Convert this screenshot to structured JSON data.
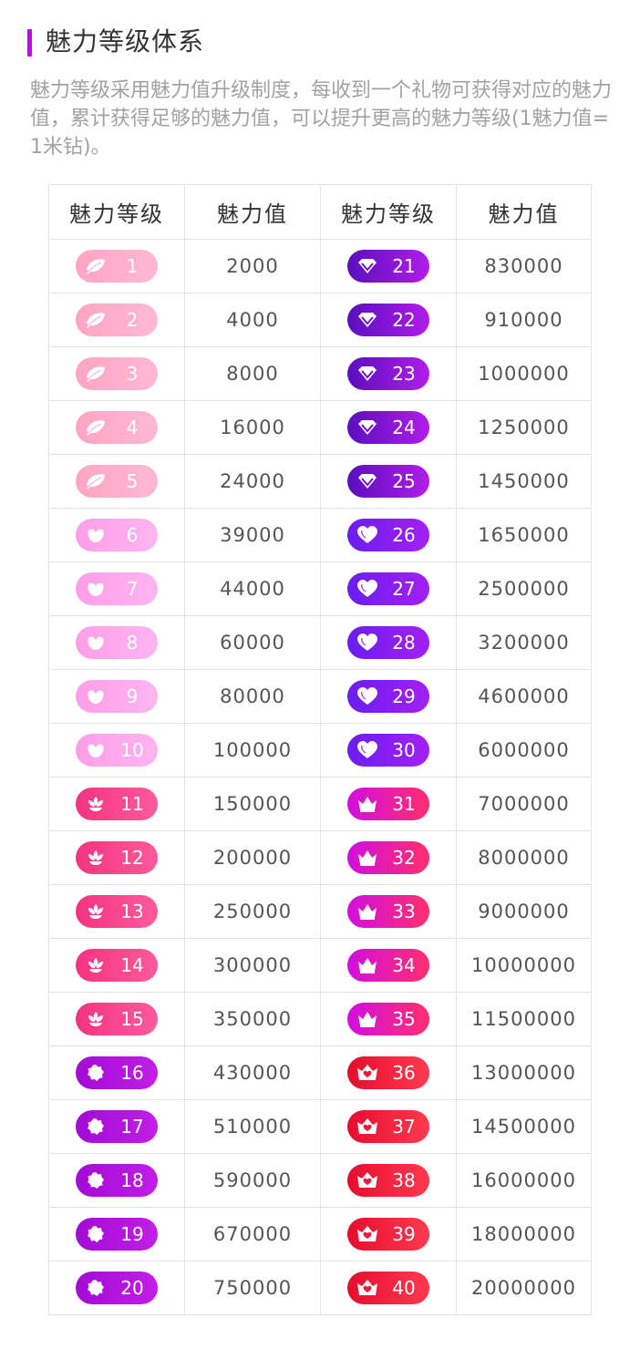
{
  "section": {
    "title": "魅力等级体系",
    "description": "魅力等级采用魅力值升级制度，每收到一个礼物可获得对应的魅力值，累计获得足够的魅力值，可以提升更高的魅力等级(1魅力值=1米钻)。"
  },
  "table": {
    "headers": [
      "魅力等级",
      "魅力值",
      "魅力等级",
      "魅力值"
    ]
  },
  "levels": [
    {
      "level": "1",
      "value": "2000",
      "icon": "leaf-icon",
      "colors": [
        "#ffa4c4",
        "#ffb8d2"
      ]
    },
    {
      "level": "2",
      "value": "4000",
      "icon": "leaf-icon",
      "colors": [
        "#ffa4c4",
        "#ffb8d2"
      ]
    },
    {
      "level": "3",
      "value": "8000",
      "icon": "leaf-icon",
      "colors": [
        "#ffa4c4",
        "#ffb8d2"
      ]
    },
    {
      "level": "4",
      "value": "16000",
      "icon": "leaf-icon",
      "colors": [
        "#ffa4c4",
        "#ffb8d2"
      ]
    },
    {
      "level": "5",
      "value": "24000",
      "icon": "leaf-icon",
      "colors": [
        "#ffa4c4",
        "#ffb8d2"
      ]
    },
    {
      "level": "6",
      "value": "39000",
      "icon": "bud-icon",
      "colors": [
        "#ff9ee8",
        "#ffb4ef"
      ]
    },
    {
      "level": "7",
      "value": "44000",
      "icon": "bud-icon",
      "colors": [
        "#ff9ee8",
        "#ffb4ef"
      ]
    },
    {
      "level": "8",
      "value": "60000",
      "icon": "bud-icon",
      "colors": [
        "#ff9ee8",
        "#ffb4ef"
      ]
    },
    {
      "level": "9",
      "value": "80000",
      "icon": "bud-icon",
      "colors": [
        "#ff9ee8",
        "#ffb4ef"
      ]
    },
    {
      "level": "10",
      "value": "100000",
      "icon": "bud-icon",
      "colors": [
        "#ff9ee8",
        "#ffb4ef"
      ]
    },
    {
      "level": "11",
      "value": "150000",
      "icon": "lotus-icon",
      "colors": [
        "#f4337f",
        "#ff5a9c"
      ]
    },
    {
      "level": "12",
      "value": "200000",
      "icon": "lotus-icon",
      "colors": [
        "#f4337f",
        "#ff5a9c"
      ]
    },
    {
      "level": "13",
      "value": "250000",
      "icon": "lotus-icon",
      "colors": [
        "#f4337f",
        "#ff5a9c"
      ]
    },
    {
      "level": "14",
      "value": "300000",
      "icon": "lotus-icon",
      "colors": [
        "#f4337f",
        "#ff5a9c"
      ]
    },
    {
      "level": "15",
      "value": "350000",
      "icon": "lotus-icon",
      "colors": [
        "#f4337f",
        "#ff5a9c"
      ]
    },
    {
      "level": "16",
      "value": "430000",
      "icon": "flower-icon",
      "colors": [
        "#a20bd6",
        "#c21ee6"
      ]
    },
    {
      "level": "17",
      "value": "510000",
      "icon": "flower-icon",
      "colors": [
        "#a20bd6",
        "#c21ee6"
      ]
    },
    {
      "level": "18",
      "value": "590000",
      "icon": "flower-icon",
      "colors": [
        "#a20bd6",
        "#c21ee6"
      ]
    },
    {
      "level": "19",
      "value": "670000",
      "icon": "flower-icon",
      "colors": [
        "#a20bd6",
        "#c21ee6"
      ]
    },
    {
      "level": "20",
      "value": "750000",
      "icon": "flower-icon",
      "colors": [
        "#a20bd6",
        "#c21ee6"
      ]
    },
    {
      "level": "21",
      "value": "830000",
      "icon": "diamond-icon",
      "colors": [
        "#5a0fbf",
        "#b01de8"
      ]
    },
    {
      "level": "22",
      "value": "910000",
      "icon": "diamond-icon",
      "colors": [
        "#5a0fbf",
        "#b01de8"
      ]
    },
    {
      "level": "23",
      "value": "1000000",
      "icon": "diamond-icon",
      "colors": [
        "#5a0fbf",
        "#b01de8"
      ]
    },
    {
      "level": "24",
      "value": "1250000",
      "icon": "diamond-icon",
      "colors": [
        "#5a0fbf",
        "#b01de8"
      ]
    },
    {
      "level": "25",
      "value": "1450000",
      "icon": "diamond-icon",
      "colors": [
        "#5a0fbf",
        "#b01de8"
      ]
    },
    {
      "level": "26",
      "value": "1650000",
      "icon": "heart-icon",
      "colors": [
        "#6a1ef0",
        "#a41ff2"
      ]
    },
    {
      "level": "27",
      "value": "2500000",
      "icon": "heart-icon",
      "colors": [
        "#6a1ef0",
        "#a41ff2"
      ]
    },
    {
      "level": "28",
      "value": "3200000",
      "icon": "heart-icon",
      "colors": [
        "#6a1ef0",
        "#a41ff2"
      ]
    },
    {
      "level": "29",
      "value": "4600000",
      "icon": "heart-icon",
      "colors": [
        "#6a1ef0",
        "#a41ff2"
      ]
    },
    {
      "level": "30",
      "value": "6000000",
      "icon": "heart-icon",
      "colors": [
        "#6a1ef0",
        "#a41ff2"
      ]
    },
    {
      "level": "31",
      "value": "7000000",
      "icon": "crown-icon",
      "colors": [
        "#d10ee0",
        "#ff2f6e"
      ]
    },
    {
      "level": "32",
      "value": "8000000",
      "icon": "crown-icon",
      "colors": [
        "#d10ee0",
        "#ff2f6e"
      ]
    },
    {
      "level": "33",
      "value": "9000000",
      "icon": "crown-icon",
      "colors": [
        "#d10ee0",
        "#ff2f6e"
      ]
    },
    {
      "level": "34",
      "value": "10000000",
      "icon": "crown-icon",
      "colors": [
        "#d10ee0",
        "#ff2f6e"
      ]
    },
    {
      "level": "35",
      "value": "11500000",
      "icon": "crown-icon",
      "colors": [
        "#d10ee0",
        "#ff2f6e"
      ]
    },
    {
      "level": "36",
      "value": "13000000",
      "icon": "heart-crown-icon",
      "colors": [
        "#e50d2f",
        "#ff3a4e"
      ]
    },
    {
      "level": "37",
      "value": "14500000",
      "icon": "heart-crown-icon",
      "colors": [
        "#e50d2f",
        "#ff3a4e"
      ]
    },
    {
      "level": "38",
      "value": "16000000",
      "icon": "heart-crown-icon",
      "colors": [
        "#e50d2f",
        "#ff3a4e"
      ]
    },
    {
      "level": "39",
      "value": "18000000",
      "icon": "heart-crown-icon",
      "colors": [
        "#e50d2f",
        "#ff3a4e"
      ]
    },
    {
      "level": "40",
      "value": "20000000",
      "icon": "heart-crown-icon",
      "colors": [
        "#e50d2f",
        "#ff3a4e"
      ]
    }
  ],
  "theme": {
    "accent": "#b40ee6",
    "border": "#e4e4e4",
    "title_color": "#333333",
    "description_color": "#a2a2a2"
  }
}
